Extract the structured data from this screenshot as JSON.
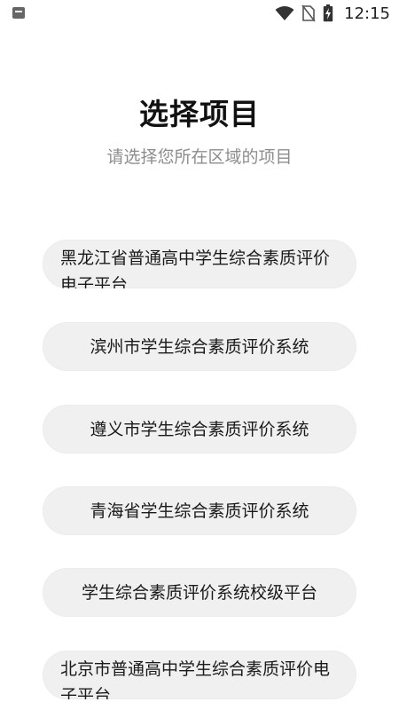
{
  "status_bar": {
    "time": "12:15",
    "icons": [
      "notification-icon",
      "wifi-icon",
      "no-sim-icon",
      "battery-charging-icon"
    ]
  },
  "header": {
    "title": "选择项目",
    "subtitle": "请选择您所在区域的项目"
  },
  "projects": [
    {
      "label": "黑龙江省普通高中学生综合素质评价电子平台"
    },
    {
      "label": "滨州市学生综合素质评价系统"
    },
    {
      "label": "遵义市学生综合素质评价系统"
    },
    {
      "label": "青海省学生综合素质评价系统"
    },
    {
      "label": "学生综合素质评价系统校级平台"
    },
    {
      "label": "北京市普通高中学生综合素质评价电子平台"
    }
  ],
  "colors": {
    "background": "#ffffff",
    "item_background": "#f0f0f0",
    "title": "#111111",
    "subtitle": "#8d8d8d"
  }
}
